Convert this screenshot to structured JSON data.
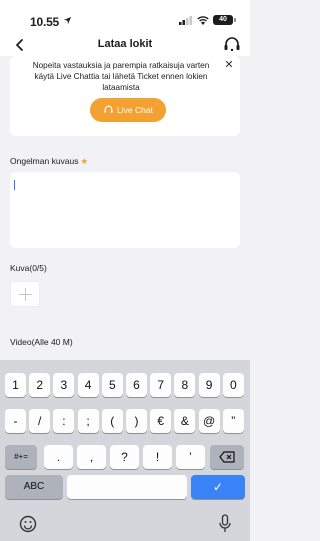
{
  "status_bar": {
    "time": "10.55",
    "battery_level": "40"
  },
  "nav": {
    "title": "Lataa lokit"
  },
  "banner": {
    "message": "Nopeita vastauksia ja parempia ratkaisuja varten käytä Live Chattia tai lähetä Ticket ennen lokien lataamista",
    "button_label": "Live Chat"
  },
  "form": {
    "description_label": "Ongelman kuvaus",
    "required_marker": "★",
    "description_value": "",
    "image_label": "Kuva(0/5)",
    "video_label": "Video(Alle 40 M)"
  },
  "keyboard": {
    "row1": [
      "1",
      "2",
      "3",
      "4",
      "5",
      "6",
      "7",
      "8",
      "9",
      "0"
    ],
    "row2": [
      "-",
      "/",
      ":",
      ";",
      "(",
      ")",
      "€",
      "&",
      "@",
      "”"
    ],
    "row3_switch": "#+=",
    "row3": [
      ".",
      ",",
      "?",
      "!",
      "’"
    ],
    "abc_label": "ABC",
    "done_label": "✓"
  },
  "colors": {
    "accent": "#f4a133",
    "keyboard_bg": "#d4d6dc",
    "done_key": "#3a83f6"
  }
}
